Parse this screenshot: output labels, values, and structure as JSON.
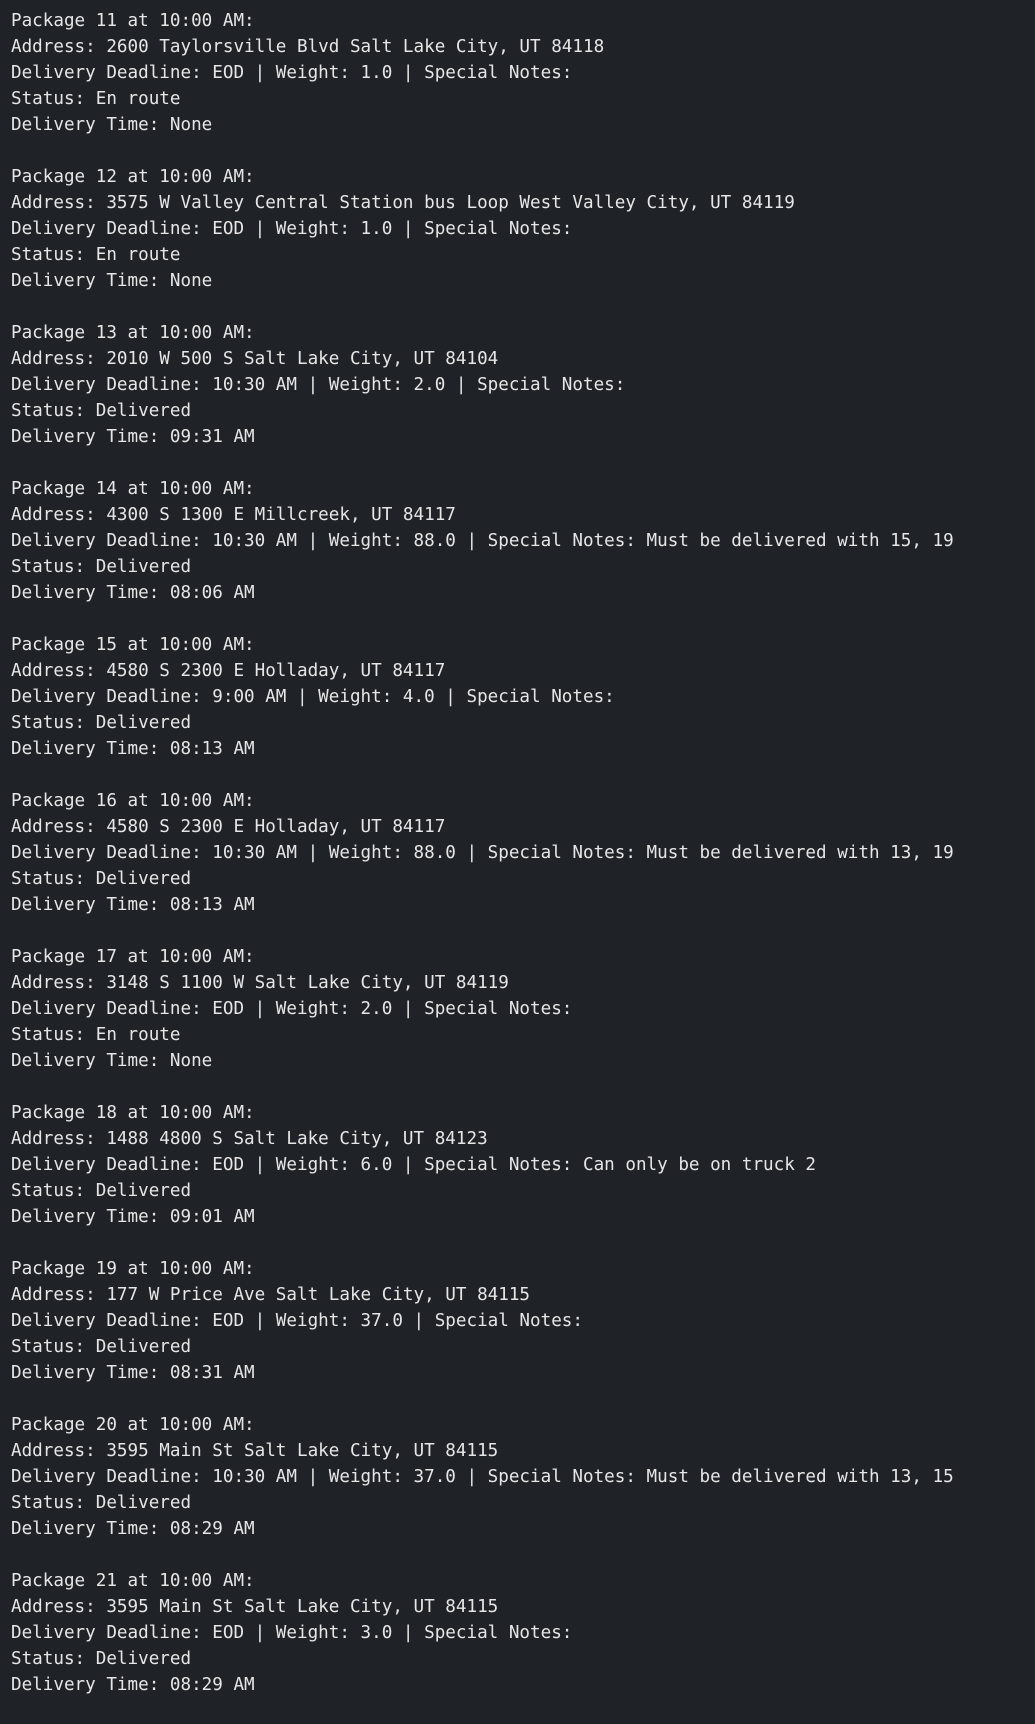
{
  "packages": [
    {
      "header": "Package 11 at 10:00 AM:",
      "address": "Address: 2600 Taylorsville Blvd Salt Lake City, UT 84118",
      "details": "Delivery Deadline: EOD | Weight: 1.0 | Special Notes:",
      "status": "Status: En route",
      "delivery_time": "Delivery Time: None"
    },
    {
      "header": "Package 12 at 10:00 AM:",
      "address": "Address: 3575 W Valley Central Station bus Loop West Valley City, UT 84119",
      "details": "Delivery Deadline: EOD | Weight: 1.0 | Special Notes:",
      "status": "Status: En route",
      "delivery_time": "Delivery Time: None"
    },
    {
      "header": "Package 13 at 10:00 AM:",
      "address": "Address: 2010 W 500 S Salt Lake City, UT 84104",
      "details": "Delivery Deadline: 10:30 AM | Weight: 2.0 | Special Notes:",
      "status": "Status: Delivered",
      "delivery_time": "Delivery Time: 09:31 AM"
    },
    {
      "header": "Package 14 at 10:00 AM:",
      "address": "Address: 4300 S 1300 E Millcreek, UT 84117",
      "details": "Delivery Deadline: 10:30 AM | Weight: 88.0 | Special Notes: Must be delivered with 15, 19",
      "status": "Status: Delivered",
      "delivery_time": "Delivery Time: 08:06 AM"
    },
    {
      "header": "Package 15 at 10:00 AM:",
      "address": "Address: 4580 S 2300 E Holladay, UT 84117",
      "details": "Delivery Deadline: 9:00 AM | Weight: 4.0 | Special Notes:",
      "status": "Status: Delivered",
      "delivery_time": "Delivery Time: 08:13 AM"
    },
    {
      "header": "Package 16 at 10:00 AM:",
      "address": "Address: 4580 S 2300 E Holladay, UT 84117",
      "details": "Delivery Deadline: 10:30 AM | Weight: 88.0 | Special Notes: Must be delivered with 13, 19",
      "status": "Status: Delivered",
      "delivery_time": "Delivery Time: 08:13 AM"
    },
    {
      "header": "Package 17 at 10:00 AM:",
      "address": "Address: 3148 S 1100 W Salt Lake City, UT 84119",
      "details": "Delivery Deadline: EOD | Weight: 2.0 | Special Notes:",
      "status": "Status: En route",
      "delivery_time": "Delivery Time: None"
    },
    {
      "header": "Package 18 at 10:00 AM:",
      "address": "Address: 1488 4800 S Salt Lake City, UT 84123",
      "details": "Delivery Deadline: EOD | Weight: 6.0 | Special Notes: Can only be on truck 2",
      "status": "Status: Delivered",
      "delivery_time": "Delivery Time: 09:01 AM"
    },
    {
      "header": "Package 19 at 10:00 AM:",
      "address": "Address: 177 W Price Ave Salt Lake City, UT 84115",
      "details": "Delivery Deadline: EOD | Weight: 37.0 | Special Notes:",
      "status": "Status: Delivered",
      "delivery_time": "Delivery Time: 08:31 AM"
    },
    {
      "header": "Package 20 at 10:00 AM:",
      "address": "Address: 3595 Main St Salt Lake City, UT 84115",
      "details": "Delivery Deadline: 10:30 AM | Weight: 37.0 | Special Notes: Must be delivered with 13, 15",
      "status": "Status: Delivered",
      "delivery_time": "Delivery Time: 08:29 AM"
    },
    {
      "header": "Package 21 at 10:00 AM:",
      "address": "Address: 3595 Main St Salt Lake City, UT 84115",
      "details": "Delivery Deadline: EOD | Weight: 3.0 | Special Notes:",
      "status": "Status: Delivered",
      "delivery_time": "Delivery Time: 08:29 AM"
    }
  ]
}
